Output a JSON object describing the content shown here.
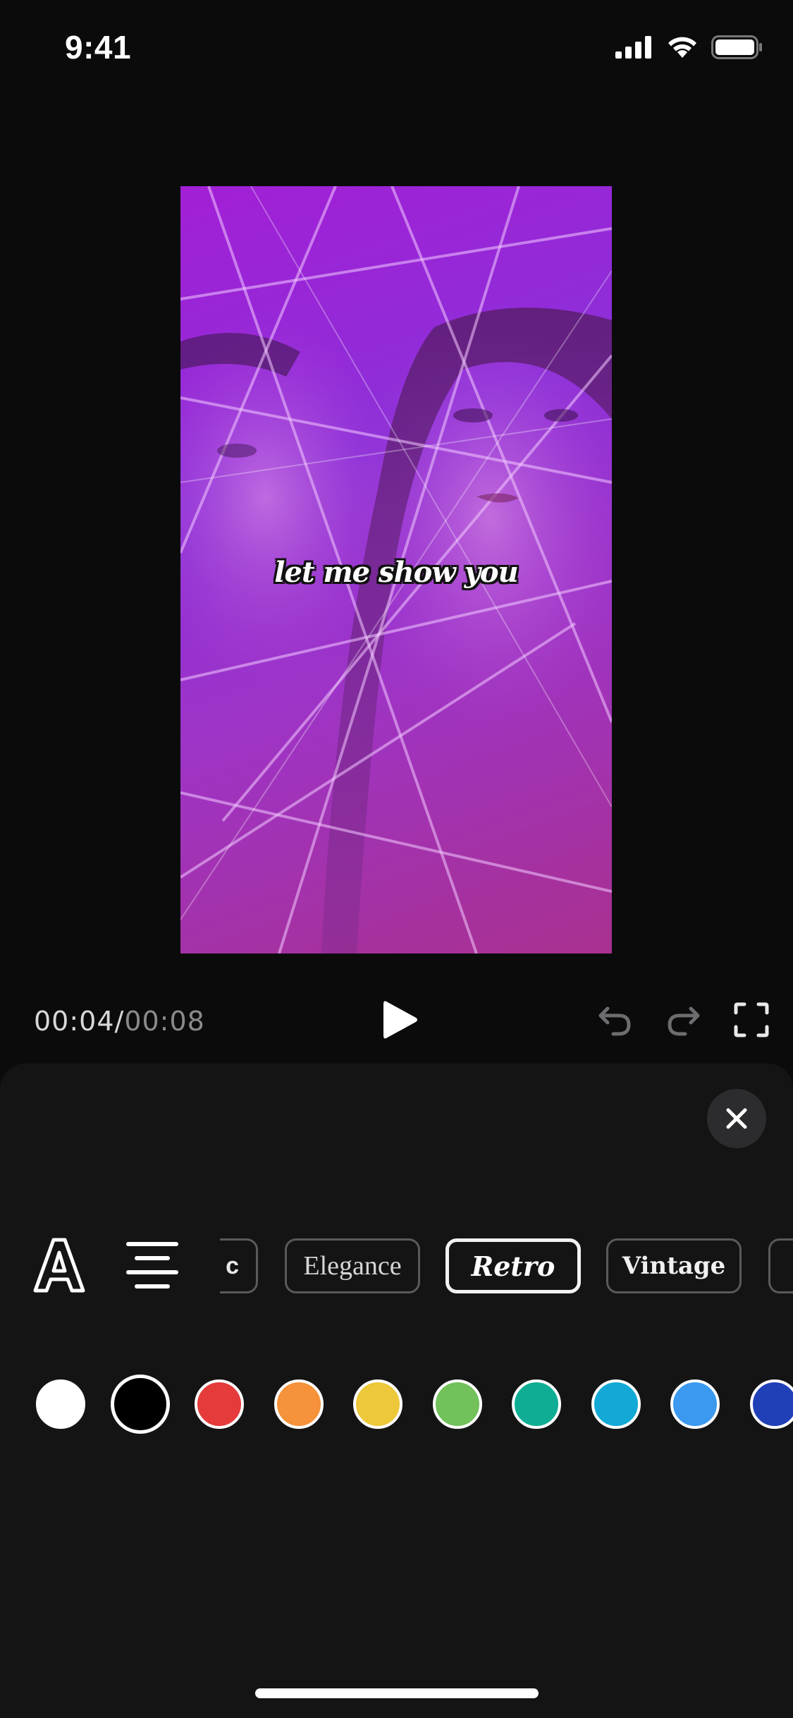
{
  "status_bar": {
    "time": "9:41",
    "icons": [
      "cellular-signal-icon",
      "wifi-icon",
      "battery-icon"
    ]
  },
  "preview": {
    "caption": "let me show you"
  },
  "playback": {
    "current_time": "00:04",
    "separator": "/",
    "total_time": "00:08",
    "icons": [
      "play-icon",
      "undo-icon",
      "redo-icon",
      "fullscreen-icon"
    ]
  },
  "sheet": {
    "close_icon": "close-icon",
    "tools": [
      "text-style-icon",
      "align-center-icon"
    ],
    "styles": [
      {
        "label": "c",
        "selected": false
      },
      {
        "label": "Elegance",
        "selected": false
      },
      {
        "label": "Retro",
        "selected": true
      },
      {
        "label": "Vintage",
        "selected": false
      },
      {
        "label": "",
        "selected": false
      }
    ],
    "colors": [
      {
        "hex": "#ffffff",
        "selected": false
      },
      {
        "hex": "#000000",
        "selected": true
      },
      {
        "hex": "#e53b3b",
        "selected": false
      },
      {
        "hex": "#f5923a",
        "selected": false
      },
      {
        "hex": "#ecc83a",
        "selected": false
      },
      {
        "hex": "#72c15b",
        "selected": false
      },
      {
        "hex": "#0fae94",
        "selected": false
      },
      {
        "hex": "#12a9d6",
        "selected": false
      },
      {
        "hex": "#3b99ef",
        "selected": false
      },
      {
        "hex": "#2040b8",
        "selected": false
      }
    ]
  }
}
